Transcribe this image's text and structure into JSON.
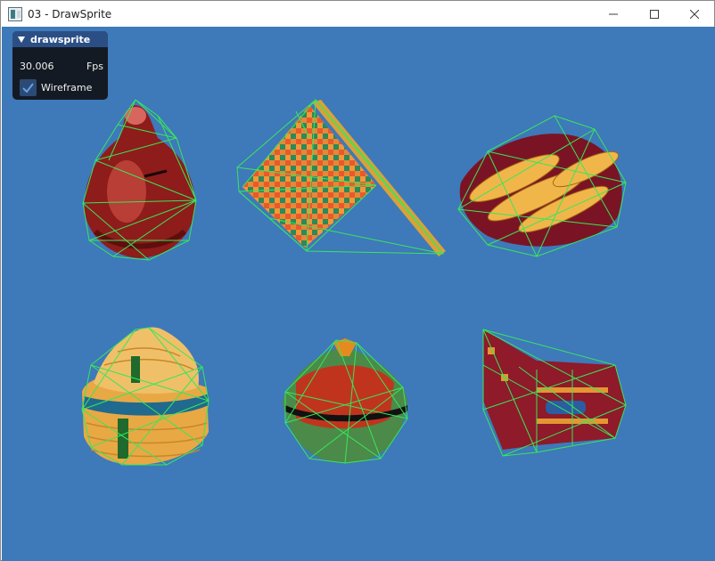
{
  "window": {
    "title": "03 - DrawSprite",
    "controls": {
      "minimize": "—",
      "maximize": "☐",
      "close": "✕"
    }
  },
  "panel": {
    "title": "drawsprite",
    "fps_value": "30.006",
    "fps_label": "Fps",
    "wireframe_label": "Wireframe",
    "wireframe_checked": true
  },
  "colors": {
    "background": "#3e79ba",
    "wireframe": "#39e65a",
    "panel_header": "#2b4f85"
  },
  "sprites": [
    "red clay pot",
    "woven tapestry mat",
    "golden beaded necklaces",
    "striped basket with lid",
    "green woven basket with lid",
    "red patterned bag"
  ]
}
